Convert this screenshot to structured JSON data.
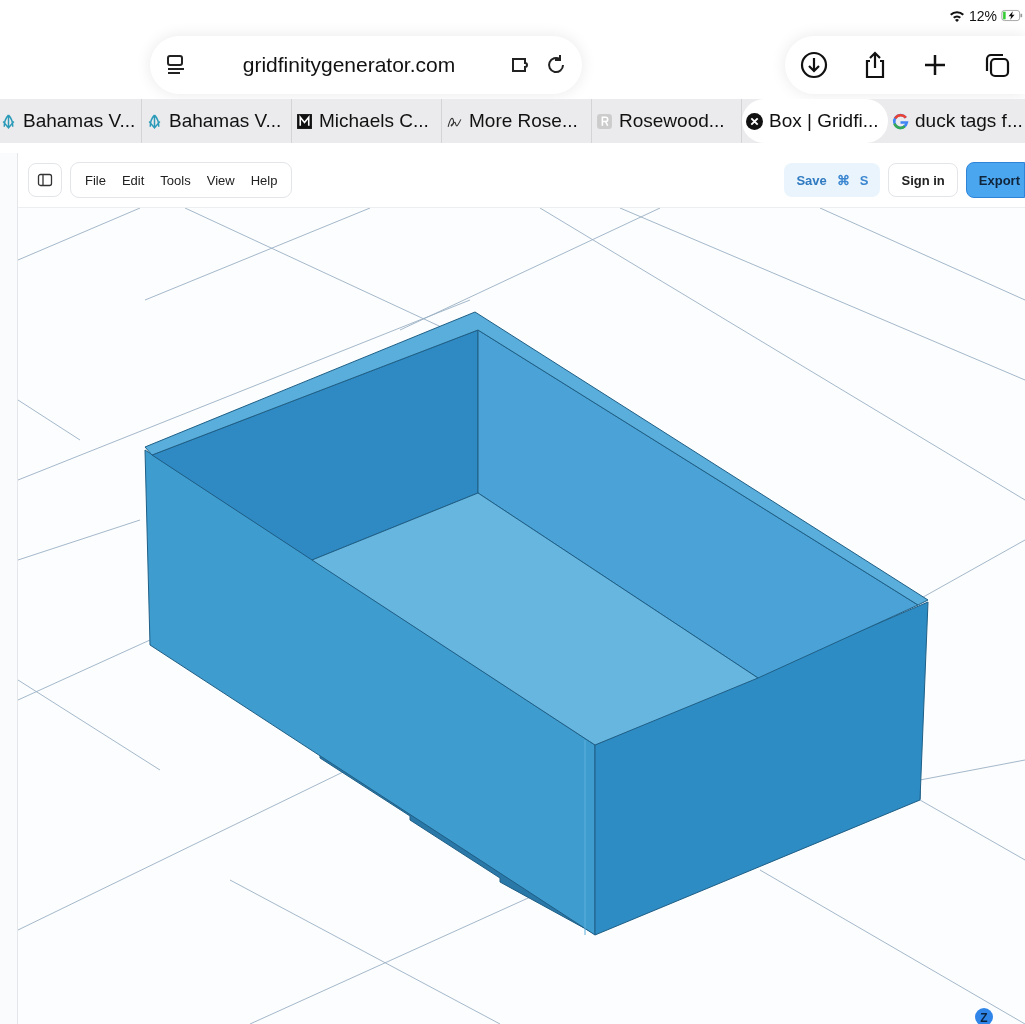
{
  "status_bar": {
    "battery": "12%"
  },
  "browser": {
    "url": "gridfinitygenerator.com",
    "tabs": [
      {
        "title": "Bahamas V...",
        "kind": "leaf",
        "selected": false
      },
      {
        "title": "Bahamas V...",
        "kind": "leaf",
        "selected": false
      },
      {
        "title": "Michaels C...",
        "kind": "dark",
        "selected": false
      },
      {
        "title": "More Rose...",
        "kind": "script",
        "selected": false
      },
      {
        "title": "Rosewood...",
        "kind": "grey",
        "selected": false
      },
      {
        "title": "Box | Gridfi...",
        "kind": "close",
        "selected": true
      },
      {
        "title": "duck tags f...",
        "kind": "google",
        "selected": false
      }
    ]
  },
  "app_toolbar": {
    "menu": [
      "File",
      "Edit",
      "Tools",
      "View",
      "Help"
    ],
    "save": {
      "label": "Save",
      "keys": [
        "⌘",
        "S"
      ]
    },
    "sign_in": "Sign in",
    "export": "Export"
  },
  "viewport": {
    "axis_label": "Z"
  }
}
